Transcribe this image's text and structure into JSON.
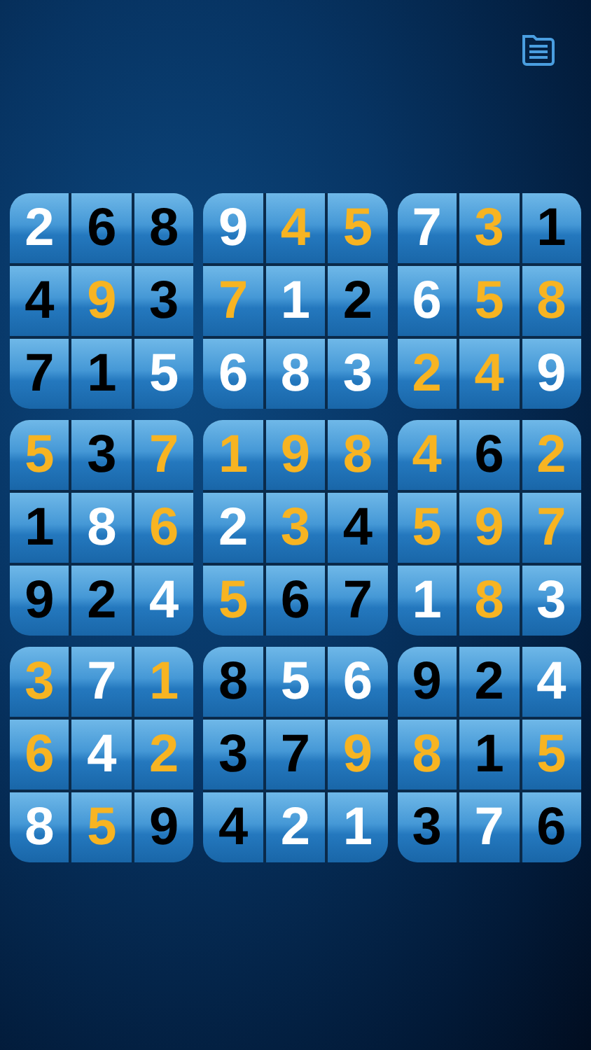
{
  "grid": {
    "boxes": [
      {
        "cells": [
          {
            "digit": "2",
            "kind": "white"
          },
          {
            "digit": "6",
            "kind": "black"
          },
          {
            "digit": "8",
            "kind": "black"
          },
          {
            "digit": "4",
            "kind": "black"
          },
          {
            "digit": "9",
            "kind": "gold"
          },
          {
            "digit": "3",
            "kind": "black"
          },
          {
            "digit": "7",
            "kind": "black"
          },
          {
            "digit": "1",
            "kind": "black"
          },
          {
            "digit": "5",
            "kind": "white"
          }
        ]
      },
      {
        "cells": [
          {
            "digit": "9",
            "kind": "white"
          },
          {
            "digit": "4",
            "kind": "gold"
          },
          {
            "digit": "5",
            "kind": "gold"
          },
          {
            "digit": "7",
            "kind": "gold"
          },
          {
            "digit": "1",
            "kind": "white"
          },
          {
            "digit": "2",
            "kind": "black"
          },
          {
            "digit": "6",
            "kind": "white"
          },
          {
            "digit": "8",
            "kind": "white"
          },
          {
            "digit": "3",
            "kind": "white"
          }
        ]
      },
      {
        "cells": [
          {
            "digit": "7",
            "kind": "white"
          },
          {
            "digit": "3",
            "kind": "gold"
          },
          {
            "digit": "1",
            "kind": "black"
          },
          {
            "digit": "6",
            "kind": "white"
          },
          {
            "digit": "5",
            "kind": "gold"
          },
          {
            "digit": "8",
            "kind": "gold"
          },
          {
            "digit": "2",
            "kind": "gold"
          },
          {
            "digit": "4",
            "kind": "gold"
          },
          {
            "digit": "9",
            "kind": "white"
          }
        ]
      },
      {
        "cells": [
          {
            "digit": "5",
            "kind": "gold"
          },
          {
            "digit": "3",
            "kind": "black"
          },
          {
            "digit": "7",
            "kind": "gold"
          },
          {
            "digit": "1",
            "kind": "black"
          },
          {
            "digit": "8",
            "kind": "white"
          },
          {
            "digit": "6",
            "kind": "gold"
          },
          {
            "digit": "9",
            "kind": "black"
          },
          {
            "digit": "2",
            "kind": "black"
          },
          {
            "digit": "4",
            "kind": "white"
          }
        ]
      },
      {
        "cells": [
          {
            "digit": "1",
            "kind": "gold"
          },
          {
            "digit": "9",
            "kind": "gold"
          },
          {
            "digit": "8",
            "kind": "gold"
          },
          {
            "digit": "2",
            "kind": "white"
          },
          {
            "digit": "3",
            "kind": "gold"
          },
          {
            "digit": "4",
            "kind": "black"
          },
          {
            "digit": "5",
            "kind": "gold"
          },
          {
            "digit": "6",
            "kind": "black"
          },
          {
            "digit": "7",
            "kind": "black"
          }
        ]
      },
      {
        "cells": [
          {
            "digit": "4",
            "kind": "gold"
          },
          {
            "digit": "6",
            "kind": "black"
          },
          {
            "digit": "2",
            "kind": "gold"
          },
          {
            "digit": "5",
            "kind": "gold"
          },
          {
            "digit": "9",
            "kind": "gold"
          },
          {
            "digit": "7",
            "kind": "gold"
          },
          {
            "digit": "1",
            "kind": "white"
          },
          {
            "digit": "8",
            "kind": "gold"
          },
          {
            "digit": "3",
            "kind": "white"
          }
        ]
      },
      {
        "cells": [
          {
            "digit": "3",
            "kind": "gold"
          },
          {
            "digit": "7",
            "kind": "white"
          },
          {
            "digit": "1",
            "kind": "gold"
          },
          {
            "digit": "6",
            "kind": "gold"
          },
          {
            "digit": "4",
            "kind": "white"
          },
          {
            "digit": "2",
            "kind": "gold"
          },
          {
            "digit": "8",
            "kind": "white"
          },
          {
            "digit": "5",
            "kind": "gold"
          },
          {
            "digit": "9",
            "kind": "black"
          }
        ]
      },
      {
        "cells": [
          {
            "digit": "8",
            "kind": "black"
          },
          {
            "digit": "5",
            "kind": "white"
          },
          {
            "digit": "6",
            "kind": "white"
          },
          {
            "digit": "3",
            "kind": "black"
          },
          {
            "digit": "7",
            "kind": "black"
          },
          {
            "digit": "9",
            "kind": "gold"
          },
          {
            "digit": "4",
            "kind": "black"
          },
          {
            "digit": "2",
            "kind": "white"
          },
          {
            "digit": "1",
            "kind": "white"
          }
        ]
      },
      {
        "cells": [
          {
            "digit": "9",
            "kind": "black"
          },
          {
            "digit": "2",
            "kind": "black"
          },
          {
            "digit": "4",
            "kind": "white"
          },
          {
            "digit": "8",
            "kind": "gold"
          },
          {
            "digit": "1",
            "kind": "black"
          },
          {
            "digit": "5",
            "kind": "gold"
          },
          {
            "digit": "3",
            "kind": "black"
          },
          {
            "digit": "7",
            "kind": "white"
          },
          {
            "digit": "6",
            "kind": "black"
          }
        ]
      }
    ]
  }
}
